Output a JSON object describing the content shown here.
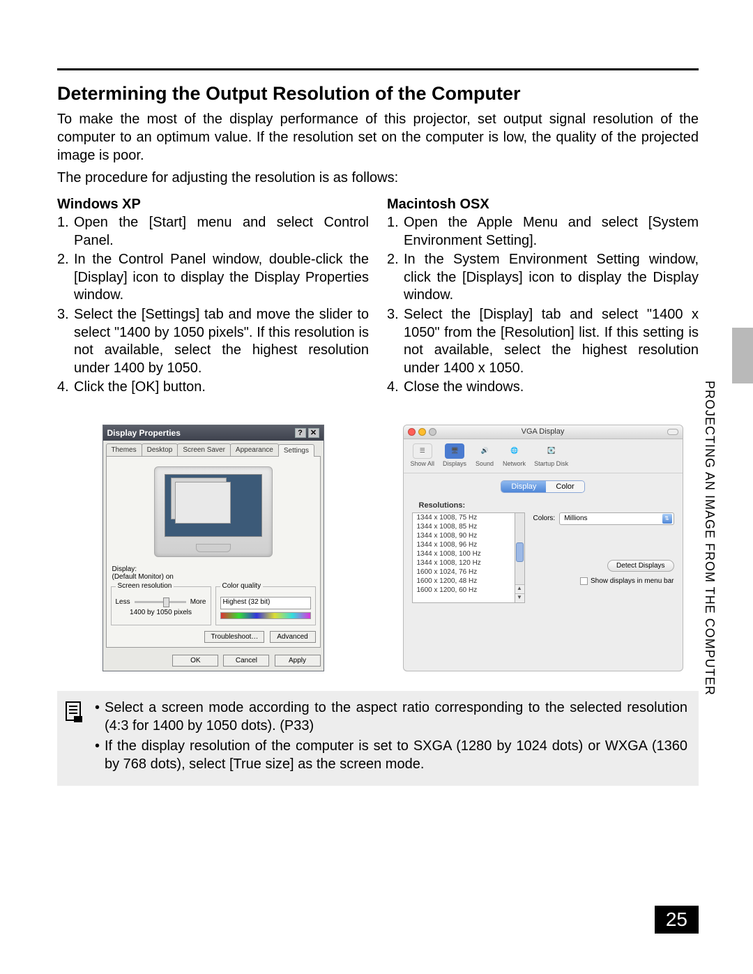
{
  "title": "Determining the Output Resolution of the Computer",
  "intro": "To make the most of the display performance of this projector, set output signal resolution of the computer to an optimum value. If the resolution set on the computer is low, the quality of the projected image is poor.",
  "procedure_line": "The procedure for adjusting the resolution is as follows:",
  "left": {
    "heading": "Windows XP",
    "steps": [
      "Open the [Start] menu and select Control Panel.",
      "In the Control Panel window, double-click the [Display] icon to display the Display Properties window.",
      "Select the [Settings] tab and move the slider to select \"1400 by 1050 pixels\". If this resolution is not available, select the highest resolution under 1400 by 1050.",
      "Click the [OK] button."
    ]
  },
  "right": {
    "heading": "Macintosh OSX",
    "steps": [
      "Open the Apple Menu and select [System Environment Setting].",
      "In the System Environment Setting window, click the [Displays] icon to display the Display window.",
      "Select the [Display] tab and select \"1400 x 1050\" from the [Resolution] list. If this setting is not available, select the highest resolution under 1400 x 1050.",
      "Close the windows."
    ]
  },
  "xp": {
    "title": "Display Properties",
    "tabs": [
      "Themes",
      "Desktop",
      "Screen Saver",
      "Appearance",
      "Settings"
    ],
    "active_tab": 4,
    "display_label": "Display:",
    "display_value": "(Default Monitor) on",
    "group_resolution": "Screen resolution",
    "less": "Less",
    "more": "More",
    "resolution_text": "1400 by 1050 pixels",
    "group_color": "Color quality",
    "color_value": "Highest (32 bit)",
    "btn_troubleshoot": "Troubleshoot…",
    "btn_advanced": "Advanced",
    "btn_ok": "OK",
    "btn_cancel": "Cancel",
    "btn_apply": "Apply"
  },
  "mac": {
    "title": "VGA Display",
    "toolbar": [
      "Show All",
      "Displays",
      "Sound",
      "Network",
      "Startup Disk"
    ],
    "segments": [
      "Display",
      "Color"
    ],
    "active_segment": 0,
    "res_label": "Resolutions:",
    "resolutions": [
      "1344 x 1008, 75 Hz",
      "1344 x 1008, 85 Hz",
      "1344 x 1008, 90 Hz",
      "1344 x 1008, 96 Hz",
      "1344 x 1008, 100 Hz",
      "1344 x 1008, 120 Hz",
      "1600 x 1024, 76 Hz",
      "1600 x 1200, 48 Hz",
      "1600 x 1200, 60 Hz"
    ],
    "colors_label": "Colors:",
    "colors_value": "Millions",
    "detect": "Detect Displays",
    "menubar": "Show displays in menu bar"
  },
  "note": {
    "items": [
      "Select a screen mode according to the aspect ratio corresponding to the selected resolution (4:3 for 1400 by 1050 dots). (P33)",
      "If the display resolution of the computer is set to SXGA (1280 by 1024 dots) or WXGA (1360 by 768 dots), select [True size] as the screen mode."
    ]
  },
  "side_text": "PROJECTING AN IMAGE FROM THE COMPUTER",
  "page_number": "25"
}
